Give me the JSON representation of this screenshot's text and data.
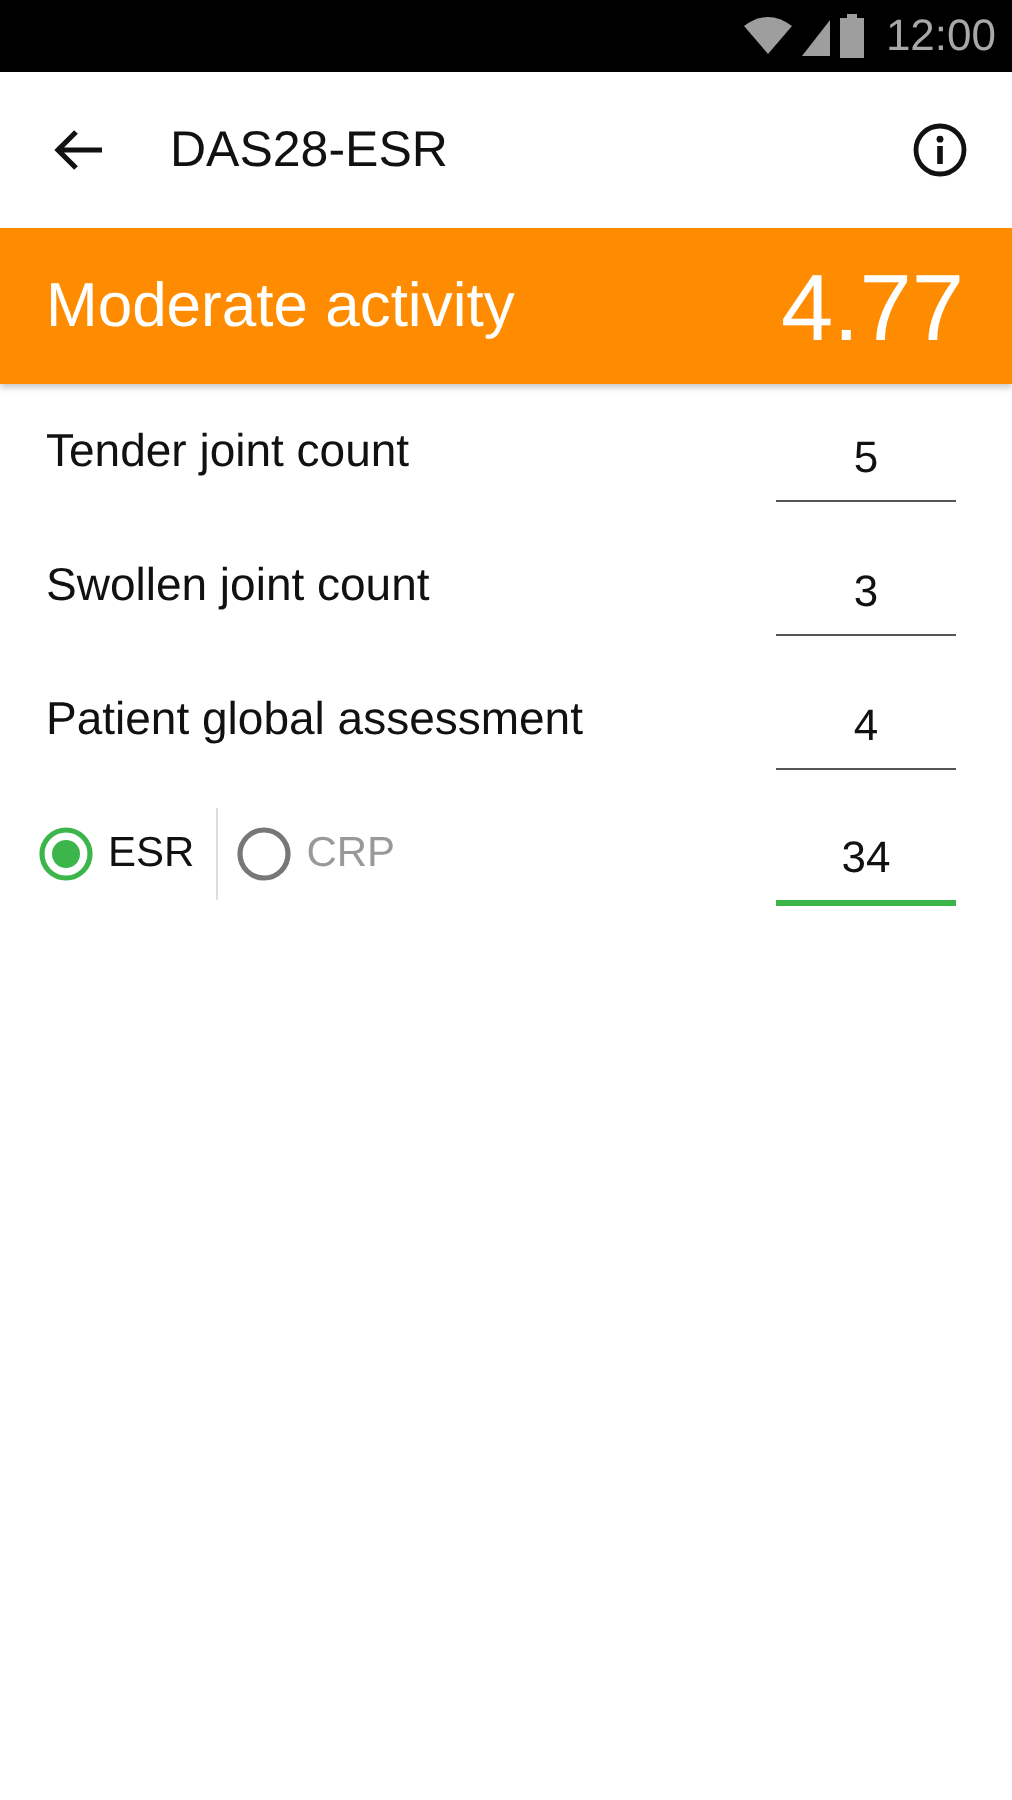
{
  "status_bar": {
    "time": "12:00"
  },
  "app_bar": {
    "title": "DAS28-ESR"
  },
  "result": {
    "label": "Moderate activity",
    "score": "4.77"
  },
  "fields": [
    {
      "label": "Tender joint count",
      "value": "5",
      "focused": false
    },
    {
      "label": "Swollen joint count",
      "value": "3",
      "focused": false
    },
    {
      "label": "Patient global assessment",
      "value": "4",
      "focused": false
    }
  ],
  "lab": {
    "options": [
      {
        "label": "ESR",
        "selected": true
      },
      {
        "label": "CRP",
        "selected": false
      }
    ],
    "value": "34",
    "focused": true
  }
}
